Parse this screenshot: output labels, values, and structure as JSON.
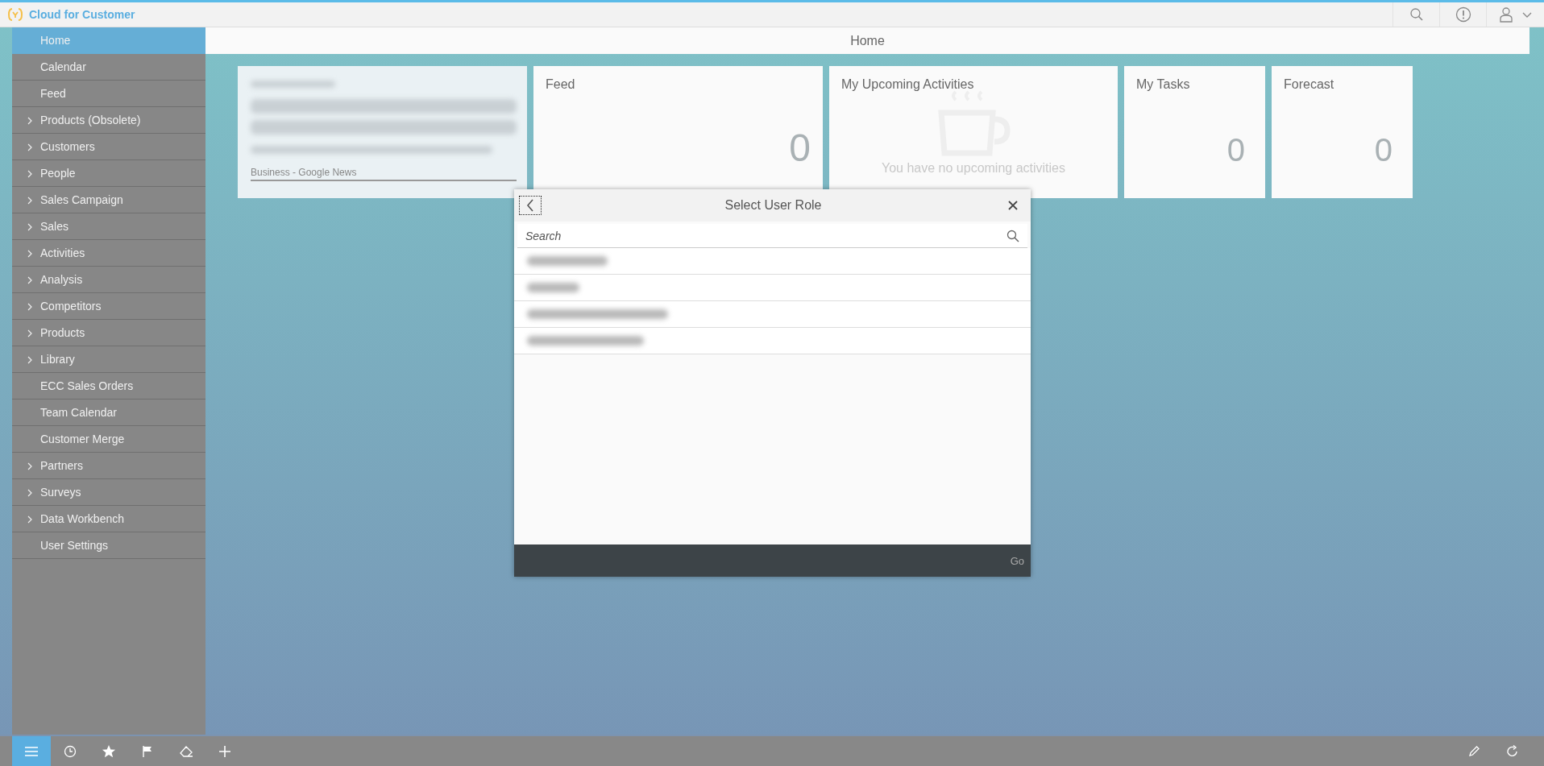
{
  "app": {
    "title": "Cloud for Customer"
  },
  "sidebar": {
    "items": [
      {
        "label": "Home",
        "selected": true,
        "expandable": false
      },
      {
        "label": "Calendar",
        "selected": false,
        "expandable": false
      },
      {
        "label": "Feed",
        "selected": false,
        "expandable": false
      },
      {
        "label": "Products (Obsolete)",
        "selected": false,
        "expandable": true
      },
      {
        "label": "Customers",
        "selected": false,
        "expandable": true
      },
      {
        "label": "People",
        "selected": false,
        "expandable": true
      },
      {
        "label": "Sales Campaign",
        "selected": false,
        "expandable": true
      },
      {
        "label": "Sales",
        "selected": false,
        "expandable": true
      },
      {
        "label": "Activities",
        "selected": false,
        "expandable": true
      },
      {
        "label": "Analysis",
        "selected": false,
        "expandable": true
      },
      {
        "label": "Competitors",
        "selected": false,
        "expandable": true
      },
      {
        "label": "Products",
        "selected": false,
        "expandable": true
      },
      {
        "label": "Library",
        "selected": false,
        "expandable": true
      },
      {
        "label": "ECC Sales Orders",
        "selected": false,
        "expandable": false
      },
      {
        "label": "Team Calendar",
        "selected": false,
        "expandable": false
      },
      {
        "label": "Customer Merge",
        "selected": false,
        "expandable": false
      },
      {
        "label": "Partners",
        "selected": false,
        "expandable": true
      },
      {
        "label": "Surveys",
        "selected": false,
        "expandable": true
      },
      {
        "label": "Data Workbench",
        "selected": false,
        "expandable": true
      },
      {
        "label": "User Settings",
        "selected": false,
        "expandable": false
      }
    ]
  },
  "page": {
    "title": "Home"
  },
  "tiles": [
    {
      "kind": "news",
      "source": "Business - Google News"
    },
    {
      "kind": "count",
      "title": "Feed",
      "count": "0"
    },
    {
      "kind": "empty",
      "title": "My Upcoming Activities",
      "message": "You have no upcoming activities"
    },
    {
      "kind": "count",
      "title": "My Tasks",
      "count": "0"
    },
    {
      "kind": "count",
      "title": "Forecast",
      "count": "0"
    }
  ],
  "dialog": {
    "title": "Select User Role",
    "search": {
      "placeholder": "Search"
    },
    "rows": [
      {
        "kind": "blurred"
      },
      {
        "kind": "blurred"
      },
      {
        "kind": "blurred"
      },
      {
        "kind": "blurred"
      }
    ],
    "footer_button": "Go"
  },
  "bottom_bar": {
    "tabs": [
      {
        "selected": true
      },
      {
        "selected": false
      },
      {
        "selected": false
      },
      {
        "selected": false
      },
      {
        "selected": false
      }
    ]
  }
}
